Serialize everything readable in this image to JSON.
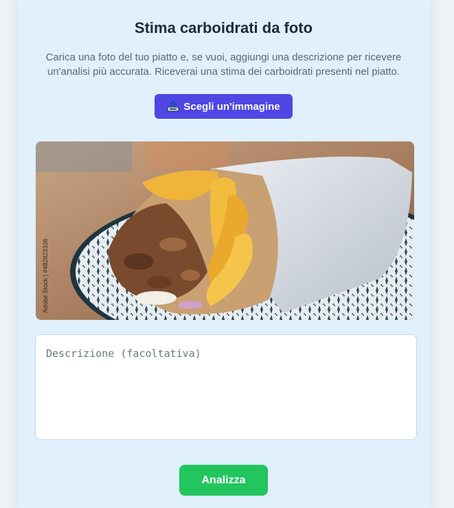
{
  "page": {
    "title": "Stima carboidrati da foto",
    "description": "Carica una foto del tuo piatto e, se vuoi, aggiungi una descrizione per ricevere un'analisi più accurata. Riceverai una stima dei carboidrati presenti nel piatto."
  },
  "upload": {
    "button_label": "Scegli un'immagine",
    "icon": "upload-tray-icon"
  },
  "photo": {
    "alt": "gyros-wrap-photo",
    "watermark": "Adobe Stock | #482823336"
  },
  "description_field": {
    "placeholder": "Descrizione (facoltativa)",
    "value": ""
  },
  "actions": {
    "analyze_label": "Analizza"
  },
  "colors": {
    "card_bg": "#e0f0fd",
    "primary": "#4f46e5",
    "success": "#22c55e"
  }
}
